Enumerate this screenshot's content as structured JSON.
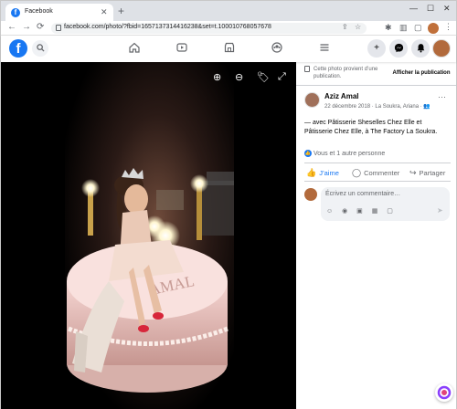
{
  "browser": {
    "tab_title": "Facebook",
    "tab_close": "✕",
    "new_tab": "+",
    "window_controls": [
      "—",
      "☐",
      "✕"
    ],
    "url": "facebook.com/photo/?fbid=1657137314416238&set=t.100010768057678",
    "nav": {
      "back": "←",
      "forward": "→",
      "reload": "⟳"
    }
  },
  "fb_header": {
    "logo": "f",
    "search_icon": "🔍",
    "nav_icons": [
      "⌂",
      "▶",
      "▤",
      "☺",
      "☰"
    ],
    "right_buttons": [
      "+",
      "✉",
      "🔔"
    ]
  },
  "photo": {
    "tools": [
      "⊕",
      "⊖",
      "🏷",
      "⤢"
    ],
    "cake_text": "AMAL"
  },
  "panel": {
    "info_note": "Cette photo provient d’une publication.",
    "show_publication": "Afficher la publication",
    "author": "Aziz Amal",
    "meta": "22 décembre 2018 · La Soukra, Ariana · 👥",
    "more": "···",
    "caption": "— avec Pâtisserie Sheselles Chez Elle et Pâtisserie Chez Elle, à The Factory La Soukra.",
    "reactions": "Vous et 1 autre personne",
    "actions": {
      "like": "J’aime",
      "comment": "Commenter",
      "share": "Partager"
    },
    "comment_placeholder": "Écrivez un commentaire…",
    "comment_icons": "☺ ◉ ▣ ▦ ▢",
    "send": "➤"
  },
  "colors": {
    "fb_blue": "#1877f2",
    "text_secondary": "#65676b"
  }
}
